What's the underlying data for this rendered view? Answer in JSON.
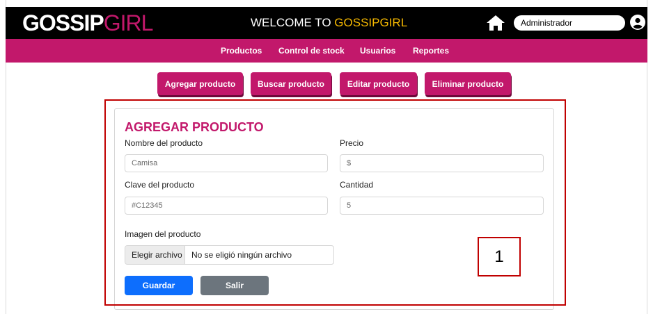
{
  "header": {
    "logo_main": "GOSSIP",
    "logo_accent": "GIRL",
    "welcome_prefix": "WELCOME TO ",
    "welcome_brand": "GOSSIPGIRL",
    "user_name": "Administrador",
    "icons": [
      "home-icon",
      "user-circle-icon"
    ]
  },
  "nav": {
    "items": [
      "Productos",
      "Control de stock",
      "Usuarios",
      "Reportes"
    ]
  },
  "actions": {
    "buttons": [
      "Agregar producto",
      "Buscar producto",
      "Editar producto",
      "Eliminar producto"
    ]
  },
  "form": {
    "title": "AGREGAR PRODUCTO",
    "name_label": "Nombre del producto",
    "name_placeholder": "Camisa",
    "price_label": "Precio",
    "price_placeholder": "$",
    "code_label": "Clave del producto",
    "code_placeholder": "#C12345",
    "qty_label": "Cantidad",
    "qty_placeholder": "5",
    "image_label": "Imagen del producto",
    "file_button": "Elegir archivo",
    "file_status": "No se eligió ningún archivo",
    "save_label": "Guardar",
    "exit_label": "Salir"
  },
  "annotation": {
    "number": "1"
  },
  "colors": {
    "brand": "#c2186b",
    "header_bg": "#000000",
    "welcome_accent": "#f5b800",
    "primary": "#0d6efd",
    "secondary": "#6c757d",
    "callout": "#c00000"
  }
}
